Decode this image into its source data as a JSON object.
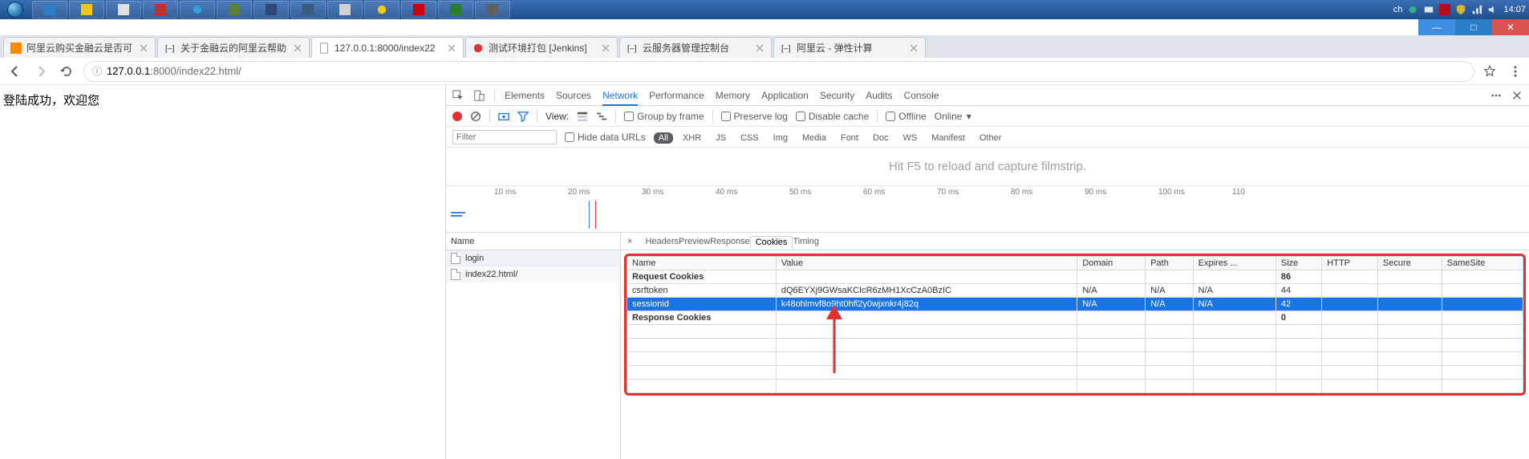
{
  "taskbar": {
    "clock": "14:07",
    "lang": "ch"
  },
  "window_controls": {
    "min": "—",
    "max": "□",
    "close": "✕"
  },
  "tabs": [
    {
      "title": "阿里云购买金融云是否可",
      "favicon": "ali"
    },
    {
      "title": "关于金融云的阿里云帮助",
      "favicon": "brackets"
    },
    {
      "title": "127.0.0.1:8000/index22",
      "favicon": "page",
      "active": true
    },
    {
      "title": "测试环境打包 [Jenkins]",
      "favicon": "jenkins"
    },
    {
      "title": "云服务器管理控制台",
      "favicon": "brackets"
    },
    {
      "title": "阿里云 - 弹性计算",
      "favicon": "brackets"
    }
  ],
  "omnibox": {
    "secure_icon_label": "ⓘ",
    "host": "127.0.0.1",
    "port": ":8000",
    "path": "/index22.html/"
  },
  "page_text": "登陆成功，欢迎您",
  "devtools": {
    "main_tabs": [
      "Elements",
      "Sources",
      "Network",
      "Performance",
      "Memory",
      "Application",
      "Security",
      "Audits",
      "Console"
    ],
    "main_active": "Network",
    "toolbar": {
      "view_label": "View:",
      "group_by_frame": "Group by frame",
      "preserve_log": "Preserve log",
      "disable_cache": "Disable cache",
      "offline": "Offline",
      "online": "Online"
    },
    "filter": {
      "placeholder": "Filter",
      "hide_data_urls": "Hide data URLs",
      "types": [
        "All",
        "XHR",
        "JS",
        "CSS",
        "Img",
        "Media",
        "Font",
        "Doc",
        "WS",
        "Manifest",
        "Other"
      ],
      "type_active": "All"
    },
    "filmstrip_hint": "Hit F5 to reload and capture filmstrip.",
    "timeline_ticks": [
      "10 ms",
      "20 ms",
      "30 ms",
      "40 ms",
      "50 ms",
      "60 ms",
      "70 ms",
      "80 ms",
      "90 ms",
      "100 ms",
      "110"
    ],
    "request_list": {
      "header": "Name",
      "items": [
        "login",
        "index22.html/"
      ]
    },
    "detail_tabs": [
      "Headers",
      "Preview",
      "Response",
      "Cookies",
      "Timing"
    ],
    "detail_active": "Cookies",
    "cookies_table": {
      "columns": [
        "Name",
        "Value",
        "Domain",
        "Path",
        "Expires ...",
        "Size",
        "HTTP",
        "Secure",
        "SameSite"
      ],
      "rows": [
        {
          "kind": "section",
          "name": "Request Cookies",
          "size": "86"
        },
        {
          "kind": "data",
          "name": "csrftoken",
          "value": "dQ6EYXj9GWsaKCIcR6zMH1XcCzA0BzIC",
          "domain": "N/A",
          "path": "N/A",
          "expires": "N/A",
          "size": "44"
        },
        {
          "kind": "data",
          "selected": true,
          "name": "sessionid",
          "value": "k48ohlmvf8o9ht0hfl2y0wjxnkr4j82q",
          "domain": "N/A",
          "path": "N/A",
          "expires": "N/A",
          "size": "42"
        },
        {
          "kind": "section",
          "name": "Response Cookies",
          "size": "0"
        }
      ]
    }
  }
}
